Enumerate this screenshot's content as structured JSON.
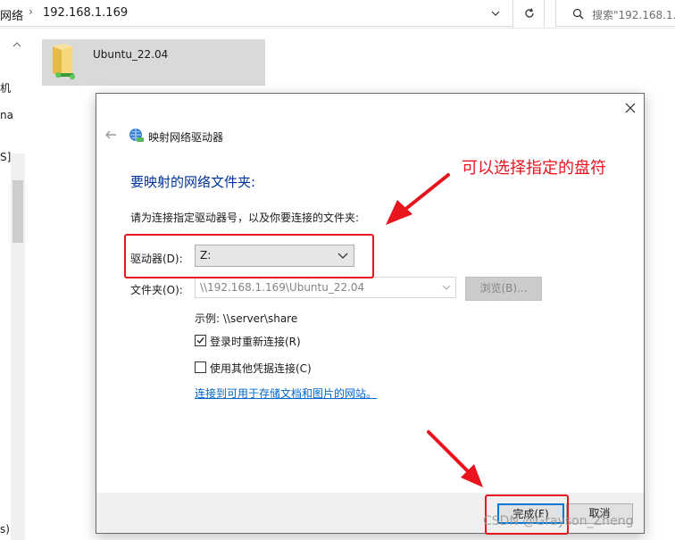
{
  "explorer": {
    "crumb_root": "网络",
    "crumb_host": "192.168.1.169",
    "search_placeholder": "搜索\"192.168.1.169\"",
    "folder_name": "Ubuntu_22.04",
    "left_fragments": [
      "机",
      "na",
      "S]",
      "s)"
    ]
  },
  "dialog": {
    "title": "映射网络驱动器",
    "heading": "要映射的网络文件夹:",
    "instruction": "请为连接指定驱动器号，以及你要连接的文件夹:",
    "drive_label": "驱动器(D):",
    "drive_value": "Z:",
    "folder_label": "文件夹(O):",
    "folder_value": "\\\\192.168.1.169\\Ubuntu_22.04",
    "browse_label": "浏览(B)...",
    "example": "示例: \\\\server\\share",
    "reconnect_label": "登录时重新连接(R)",
    "reconnect_checked": true,
    "other_creds_label": "使用其他凭据连接(C)",
    "other_creds_checked": false,
    "storage_link": "连接到可用于存储文档和图片的网站。",
    "finish_label": "完成(F)",
    "cancel_label": "取消"
  },
  "annotation": {
    "note": "可以选择指定的盘符",
    "color": "#e8141e"
  },
  "watermark": "CSDN @Grayson_Zheng"
}
